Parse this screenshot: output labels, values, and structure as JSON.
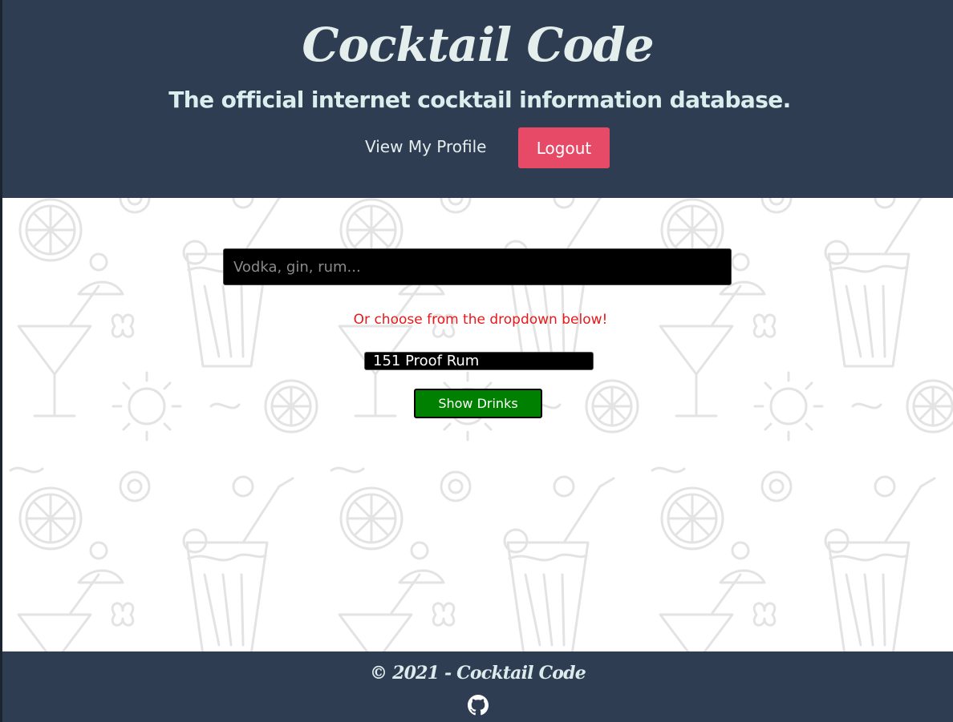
{
  "header": {
    "brand": "Cocktail Code",
    "tagline": "The official internet cocktail information database.",
    "profile_link": "View My Profile",
    "logout_label": "Logout"
  },
  "search": {
    "placeholder": "Vodka, gin, rum...",
    "value": ""
  },
  "hint": "Or choose from the dropdown below!",
  "dropdown": {
    "selected": "151 Proof Rum"
  },
  "show_button": "Show Drinks",
  "footer": {
    "copyright": "© 2021 - Cocktail Code",
    "github_icon": "github-icon"
  },
  "colors": {
    "navy": "#2e3d51",
    "accent_pink": "#e74a67",
    "button_green": "#008000",
    "hint_red": "#e8181a",
    "text_light": "#e4efed"
  }
}
